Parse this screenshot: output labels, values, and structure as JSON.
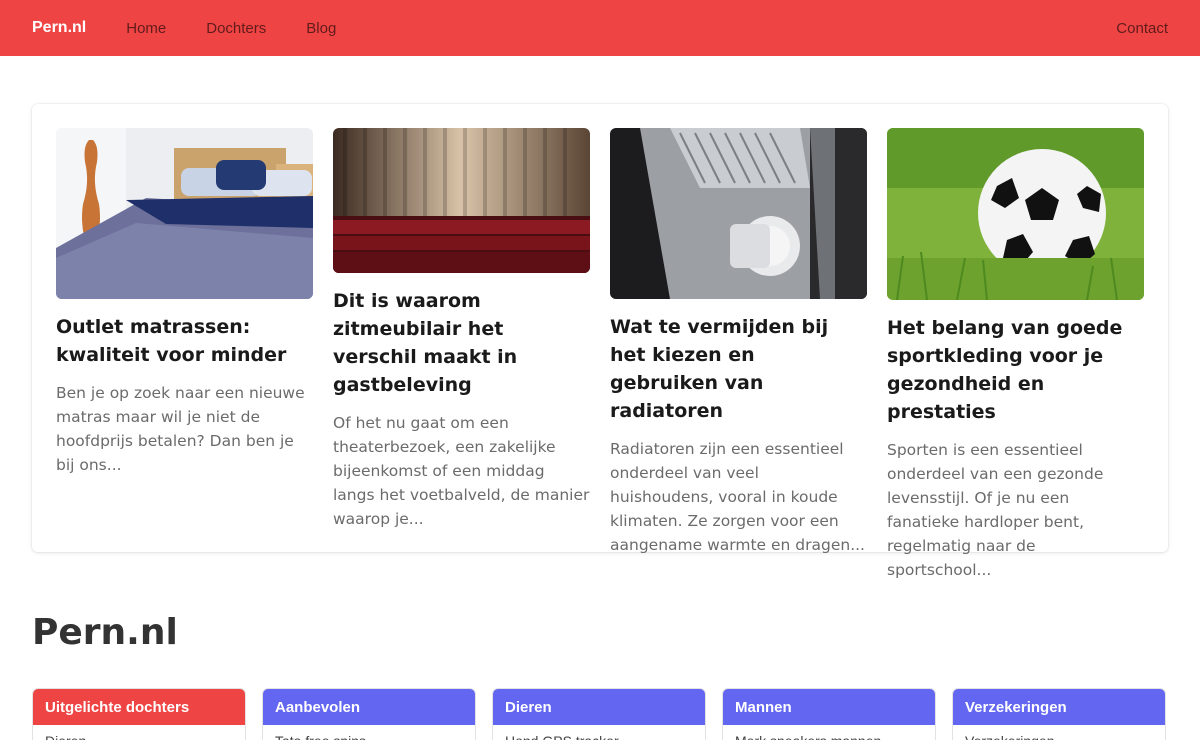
{
  "nav": {
    "brand": "Pern.nl",
    "links": [
      "Home",
      "Dochters",
      "Blog"
    ],
    "contact": "Contact"
  },
  "articles": [
    {
      "title": "Outlet matrassen: kwaliteit voor minder",
      "excerpt": "Ben je op zoek naar een nieuwe matras maar wil je niet de hoofdprijs betalen? Dan ben je bij ons...",
      "image": "bedroom-photo"
    },
    {
      "title": "Dit is waarom zitmeubilair het verschil maakt in gastbeleving",
      "excerpt": "Of het nu gaat om een theaterbezoek, een zakelijke bijeenkomst of een middag langs het voetbalveld, de manier waarop je...",
      "image": "theater-seats-photo"
    },
    {
      "title": "Wat te vermijden bij het kiezen en gebruiken van radiatoren",
      "excerpt": "Radiatoren zijn een essentieel onderdeel van veel huishoudens, vooral in koude klimaten. Ze zorgen voor een aangename warmte en dragen...",
      "image": "radiator-photo"
    },
    {
      "title": "Het belang van goede sportkleding voor je gezondheid en prestaties",
      "excerpt": "Sporten is een essentieel onderdeel van een gezonde levensstijl. Of je nu een fanatieke hardloper bent, regelmatig naar de sportschool...",
      "image": "soccer-ball-photo"
    }
  ],
  "site_heading": "Pern.nl",
  "categories": [
    {
      "title": "Uitgelichte dochters",
      "color": "#ef4444",
      "first_item": "Dieren"
    },
    {
      "title": "Aanbevolen",
      "color": "#6366f1",
      "first_item": "Tata free spins"
    },
    {
      "title": "Dieren",
      "color": "#6366f1",
      "first_item": "Hond GPS tracker"
    },
    {
      "title": "Mannen",
      "color": "#6366f1",
      "first_item": "Merk sneakers mannen"
    },
    {
      "title": "Verzekeringen",
      "color": "#6366f1",
      "first_item": "Verzekeringen"
    }
  ]
}
